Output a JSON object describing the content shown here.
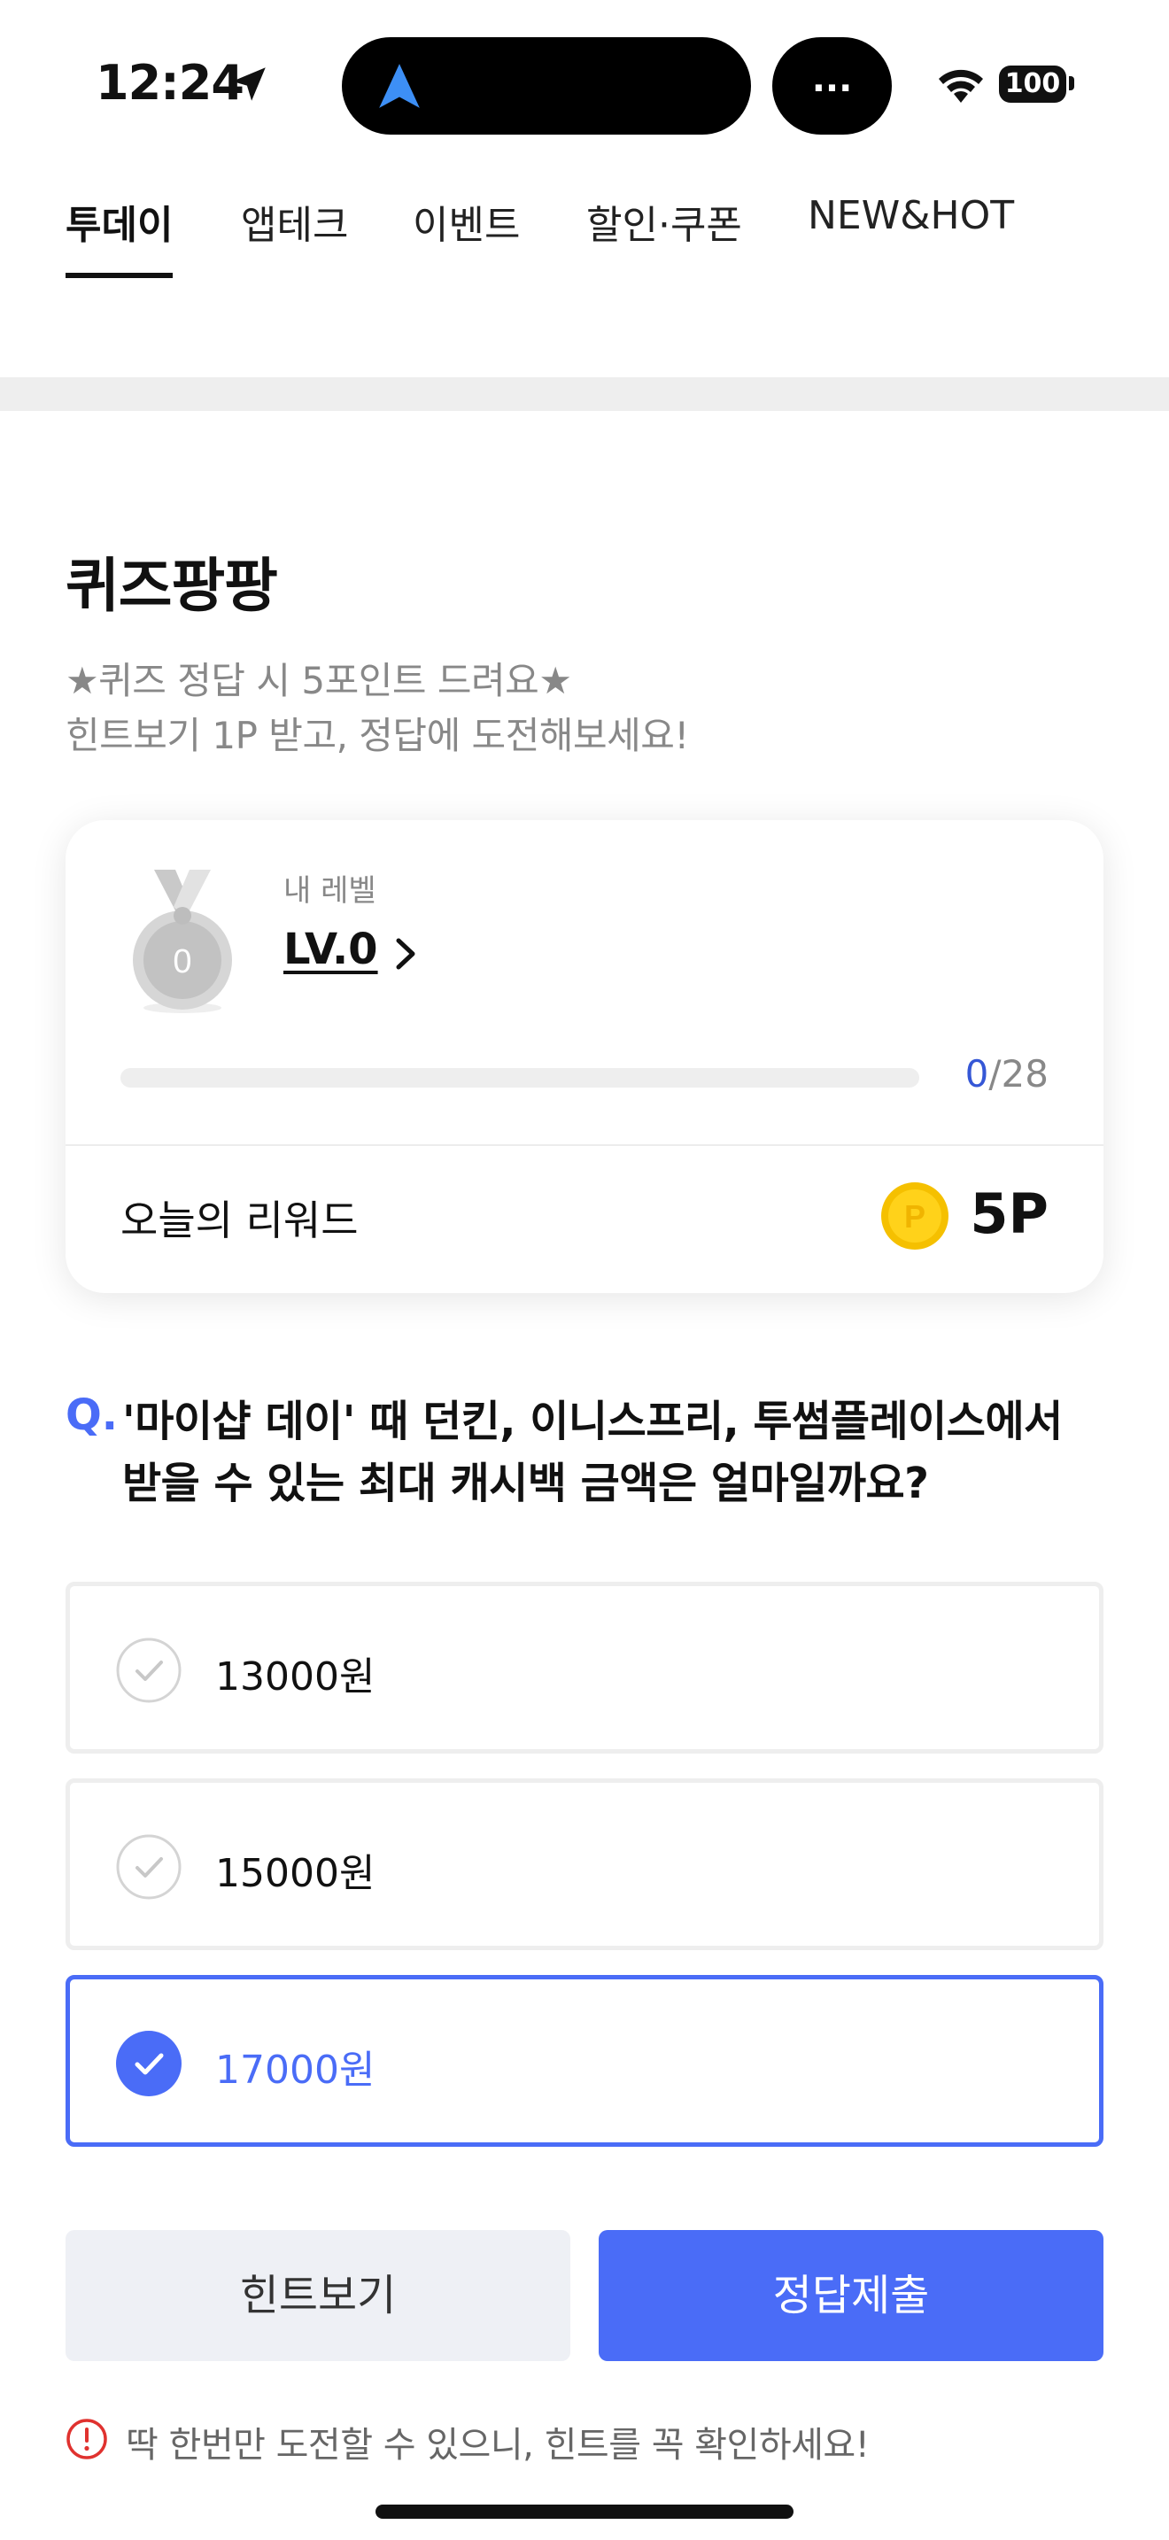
{
  "status_bar": {
    "time": "12:24",
    "island_pill_label": "...",
    "battery": "100",
    "location_icon": "location-arrow-icon",
    "island_nav_icon": "navigation-arrow-icon",
    "wifi_icon": "wifi-icon",
    "nav_accent_color": "#3d8ff5"
  },
  "tabs": [
    {
      "label": "투데이",
      "active": true
    },
    {
      "label": "앱테크",
      "active": false
    },
    {
      "label": "이벤트",
      "active": false
    },
    {
      "label": "할인·쿠폰",
      "active": false
    },
    {
      "label": "NEW&HOT",
      "active": false
    }
  ],
  "quiz": {
    "title": "퀴즈팡팡",
    "subtitle_line1": "★퀴즈 정답 시 5포인트 드려요★",
    "subtitle_line2": "힌트보기 1P 받고, 정답에 도전해보세요!"
  },
  "level_card": {
    "label": "내 레벨",
    "level": "LV.0",
    "medal_number": "0",
    "progress_current": "0",
    "progress_total": "/28",
    "progress_fraction": 0,
    "reward_label": "오늘의 리워드",
    "reward_value": "5P",
    "coin_letter": "P",
    "coin_icon": "coin-icon",
    "medal_icon": "medal-icon"
  },
  "question": {
    "mark": "Q.",
    "line1": "'마이샵 데이' 때 던킨, 이니스프리, 투썸플레이스에서",
    "line2": "받을 수 있는 최대 캐시백 금액은 얼마일까요?"
  },
  "options": [
    {
      "label": "13000원",
      "selected": false
    },
    {
      "label": "15000원",
      "selected": false
    },
    {
      "label": "17000원",
      "selected": true
    }
  ],
  "buttons": {
    "hint": "힌트보기",
    "submit": "정답제출"
  },
  "warning": {
    "text": "딱 한번만 도전할 수 있으니, 힌트를 꼭 확인하세요!",
    "icon": "alert-circle-icon"
  },
  "colors": {
    "accent": "#4a6cf7",
    "warning": "#e0322f",
    "coin": "#f5c000"
  }
}
